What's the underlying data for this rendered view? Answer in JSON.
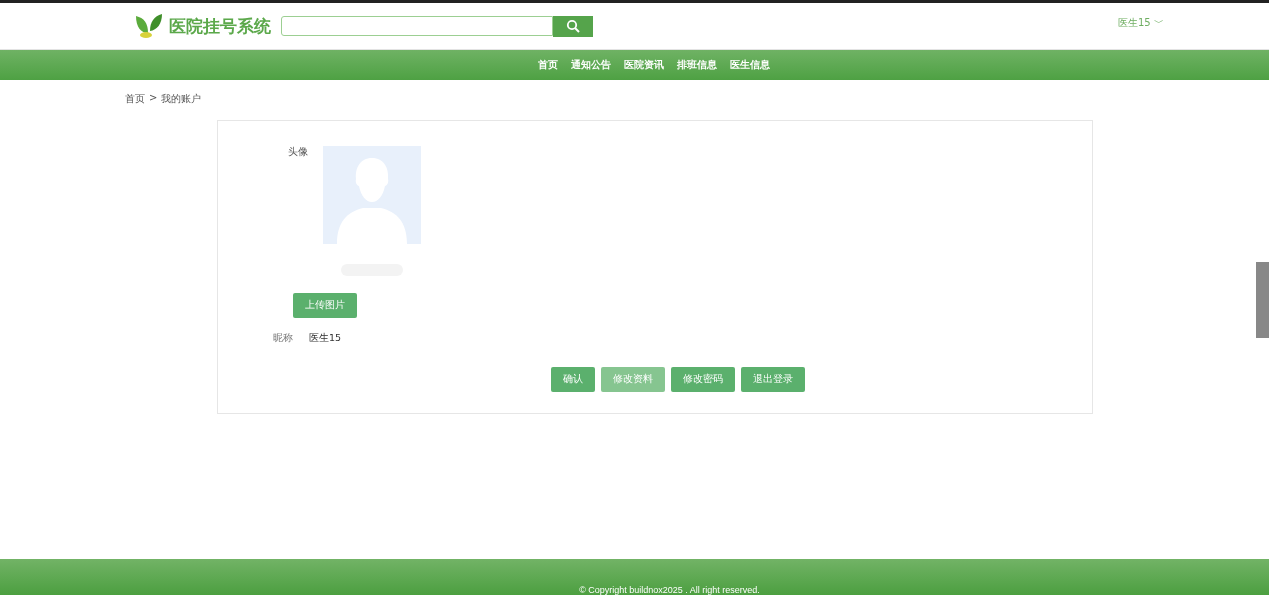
{
  "header": {
    "logo_text": "医院挂号系统",
    "user": {
      "name": "医生15",
      "caret": "﹀"
    }
  },
  "nav": [
    {
      "label": "首页"
    },
    {
      "label": "通知公告"
    },
    {
      "label": "医院资讯"
    },
    {
      "label": "排班信息"
    },
    {
      "label": "医生信息"
    }
  ],
  "breadcrumb": [
    {
      "label": "首页"
    },
    {
      "label": ">"
    },
    {
      "label": "我的账户"
    }
  ],
  "profile": {
    "avatar_label": "头像",
    "upload_button": "上传图片",
    "nickname_label": "昵称",
    "nickname": "医生15"
  },
  "buttons": [
    {
      "label": "确认",
      "hovered": false
    },
    {
      "label": "修改资料",
      "hovered": true
    },
    {
      "label": "修改密码",
      "hovered": false
    },
    {
      "label": "退出登录",
      "hovered": false
    }
  ],
  "footer": {
    "text": "© Copyright buildnox2025 . All right reserved."
  }
}
